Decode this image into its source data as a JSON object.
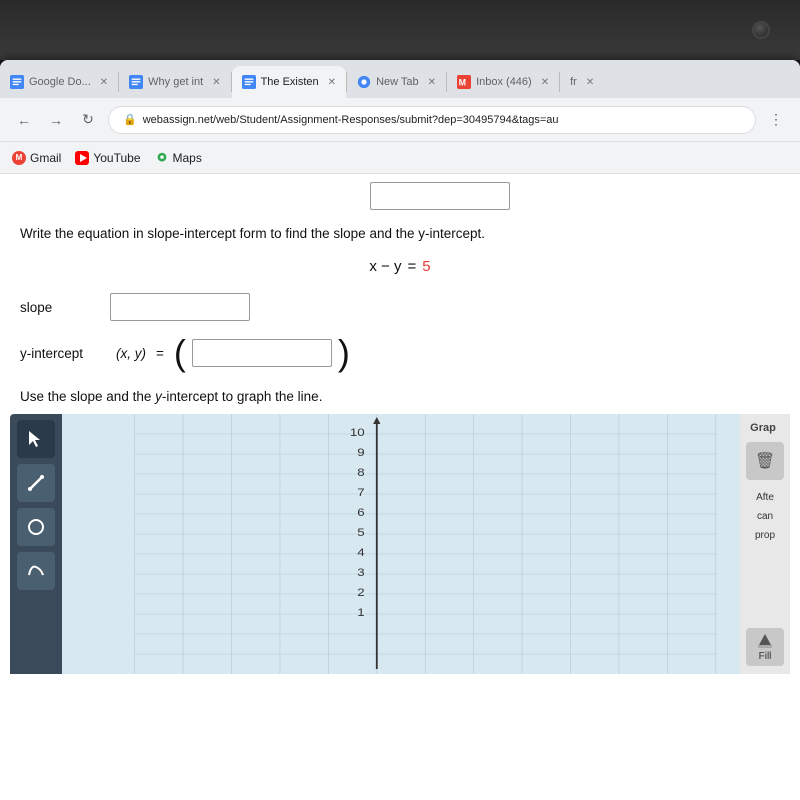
{
  "device": {
    "top_bg": "#2a2a2a"
  },
  "browser": {
    "tabs": [
      {
        "label": "Google Do...",
        "icon": "google-docs-icon",
        "active": false,
        "id": "tab-gdocs"
      },
      {
        "label": "Why get int",
        "icon": "gdocs-icon",
        "active": false,
        "id": "tab-why"
      },
      {
        "label": "The Existen",
        "icon": "gdocs-icon",
        "active": true,
        "id": "tab-existen"
      },
      {
        "label": "New Tab",
        "icon": "chrome-icon",
        "active": false,
        "id": "tab-newtab"
      },
      {
        "label": "Inbox (446)",
        "icon": "gmail-icon",
        "active": false,
        "id": "tab-inbox"
      },
      {
        "label": "fr",
        "icon": "tab-icon",
        "active": false,
        "id": "tab-fr"
      }
    ],
    "address": "webassign.net/web/Student/Assignment-Responses/submit?dep=30495794&tags=au",
    "lock_icon": "🔒",
    "bookmarks": [
      {
        "label": "Gmail",
        "icon": "gmail"
      },
      {
        "label": "YouTube",
        "icon": "youtube"
      },
      {
        "label": "Maps",
        "icon": "maps"
      }
    ]
  },
  "page": {
    "top_answer_box_visible": true,
    "instruction": "Write the equation in slope-intercept form to find the slope and the y-intercept.",
    "equation": {
      "left": "x − y",
      "operator": "=",
      "right": "5"
    },
    "slope_label": "slope",
    "yintercept_label": "y-intercept",
    "xy_label": "(x, y)",
    "equals": "=",
    "graph_instruction_start": "Use the slope and the ",
    "graph_instruction_italic": "y",
    "graph_instruction_end": "-intercept to graph the line.",
    "graph": {
      "y_axis_max": 10,
      "y_axis_labels": [
        "10",
        "9",
        "8",
        "7",
        "6",
        "5",
        "4",
        "3",
        "2",
        "1"
      ],
      "accent_color": "#3a4a5a"
    },
    "tools": [
      {
        "name": "cursor",
        "symbol": "↖",
        "active": true
      },
      {
        "name": "line",
        "symbol": "↗",
        "active": false
      },
      {
        "name": "circle",
        "symbol": "○",
        "active": false
      },
      {
        "name": "curve",
        "symbol": "∪",
        "active": false
      }
    ],
    "right_panel": {
      "graph_label": "Grap",
      "after_label": "Afte",
      "can_label": "can",
      "prop_label": "prop",
      "fill_label": "Fill",
      "trash_icon": "🗑"
    }
  }
}
